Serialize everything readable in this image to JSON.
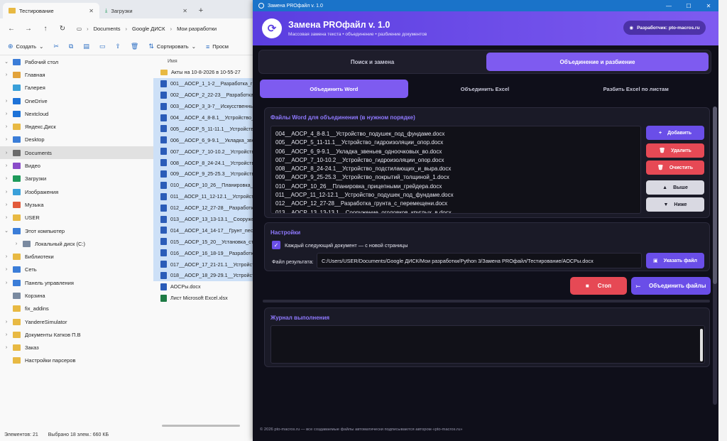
{
  "explorer": {
    "tabs": [
      {
        "label": "Тестирование",
        "active": true
      },
      {
        "label": "Загрузки",
        "active": false
      }
    ],
    "address": [
      "Documents",
      "Google ДИСК",
      "Мои разработки"
    ],
    "commands": {
      "create": "Создать",
      "sort": "Сортировать",
      "view": "Просм"
    },
    "nav_items": [
      {
        "label": "Рабочий стол",
        "expand": "⌄",
        "color": "#3b7dd8",
        "sel": false
      },
      {
        "label": "Главная",
        "expand": "›",
        "color": "#e2a33b",
        "sel": false
      },
      {
        "label": "Галерея",
        "expand": "",
        "color": "#3aa0d9",
        "sel": false
      },
      {
        "label": "OneDrive",
        "expand": "›",
        "color": "#1e73d8",
        "sel": false
      },
      {
        "label": "Nextcloud",
        "expand": "›",
        "color": "#1e73d8",
        "sel": false
      },
      {
        "label": "Яндекс.Диск",
        "expand": "›",
        "color": "#e8b943",
        "sel": false
      },
      {
        "label": "Desktop",
        "expand": "›",
        "color": "#3b7dd8",
        "sel": false
      },
      {
        "label": "Documents",
        "expand": "›",
        "color": "#6b6b6b",
        "sel": true
      },
      {
        "label": "Видео",
        "expand": "›",
        "color": "#8a4cc9",
        "sel": false
      },
      {
        "label": "Загрузки",
        "expand": "›",
        "color": "#1e9a5a",
        "sel": false
      },
      {
        "label": "Изображения",
        "expand": "›",
        "color": "#3aa0d9",
        "sel": false
      },
      {
        "label": "Музыка",
        "expand": "›",
        "color": "#e25b3b",
        "sel": false
      },
      {
        "label": "USER",
        "expand": "›",
        "color": "#e8b943",
        "sel": false
      },
      {
        "label": "Этот компьютер",
        "expand": "⌄",
        "color": "#3b7dd8",
        "sel": false
      },
      {
        "label": "Локальный диск (C:)",
        "expand": "›",
        "color": "#7a8aa0",
        "sel": false
      },
      {
        "label": "Библиотеки",
        "expand": "›",
        "color": "#e8b943",
        "sel": false
      },
      {
        "label": "Сеть",
        "expand": "›",
        "color": "#3b7dd8",
        "sel": false
      },
      {
        "label": "Панель управления",
        "expand": "›",
        "color": "#3b7dd8",
        "sel": false
      },
      {
        "label": "Корзина",
        "expand": "",
        "color": "#7a8aa0",
        "sel": false
      },
      {
        "label": "fix_addins",
        "expand": "",
        "color": "#e8b943",
        "sel": false
      },
      {
        "label": "YandereSimulator",
        "expand": "›",
        "color": "#e8b943",
        "sel": false
      },
      {
        "label": "Документы Катков П.В",
        "expand": "›",
        "color": "#e8b943",
        "sel": false
      },
      {
        "label": "Заказ",
        "expand": "›",
        "color": "#e8b943",
        "sel": false
      },
      {
        "label": "Настройки парсеров",
        "expand": "",
        "color": "#e8b943",
        "sel": false
      }
    ],
    "column_header": "Имя",
    "files": [
      {
        "name": "Акты на 10-8-2026 в 10-55-27",
        "kind": "folder",
        "sel": false
      },
      {
        "name": "001__АОСР_1_1-2__Разработка_грунт",
        "kind": "doc",
        "sel": true
      },
      {
        "name": "002__АОСР_2_22-23__Разработка_грун",
        "kind": "doc",
        "sel": true
      },
      {
        "name": "003__АОСР_3_3-7__Искусственные_с",
        "kind": "doc",
        "sel": true
      },
      {
        "name": "004__АОСР_4_8-8.1__Устройство_под",
        "kind": "doc",
        "sel": true
      },
      {
        "name": "005__АОСР_5_11-11.1__Устройство_г",
        "kind": "doc",
        "sel": true
      },
      {
        "name": "006__АОСР_6_9-9.1__Укладка_звенье",
        "kind": "doc",
        "sel": true
      },
      {
        "name": "007__АОСР_7_10-10.2__Устройство_ги",
        "kind": "doc",
        "sel": true
      },
      {
        "name": "008__АОСР_8_24-24.1__Устройство_по",
        "kind": "doc",
        "sel": true
      },
      {
        "name": "009__АОСР_9_25-25.3__Устройство_п",
        "kind": "doc",
        "sel": true
      },
      {
        "name": "010__АОСР_10_26__Планировка_приц",
        "kind": "doc",
        "sel": true
      },
      {
        "name": "011__АОСР_11_12-12.1__Устройство_",
        "kind": "doc",
        "sel": true
      },
      {
        "name": "012__АОСР_12_27-28__Разработка_гру",
        "kind": "doc",
        "sel": true
      },
      {
        "name": "013__АОСР_13_13-13.1__Сооружение",
        "kind": "doc",
        "sel": true
      },
      {
        "name": "014__АОСР_14_14-17__Грунт_песчан",
        "kind": "doc",
        "sel": true
      },
      {
        "name": "015__АОСР_15_20__Установка_столб",
        "kind": "doc",
        "sel": true
      },
      {
        "name": "016__АОСР_16_18-19__Разработка_гр",
        "kind": "doc",
        "sel": true
      },
      {
        "name": "017__АОСР_17_21-21.1__Устройство_",
        "kind": "doc",
        "sel": true
      },
      {
        "name": "018__АОСР_18_29-29.1__Устройство_",
        "kind": "doc",
        "sel": true
      },
      {
        "name": "АОСРы.docx",
        "kind": "doc",
        "sel": false
      },
      {
        "name": "Лист Microsoft Excel.xlsx",
        "kind": "xls",
        "sel": false
      }
    ],
    "status": {
      "count": "Элементов: 21",
      "selected": "Выбрано 18 элем.: 660 КБ"
    }
  },
  "app": {
    "window_title": "Замена PROфайл v. 1.0",
    "header_title": "Замена PROфайл v. 1.0",
    "header_sub": "Массовая замена текста  •  объединение  •  разбиение документов",
    "dev_label": "Разработчик: pto-macros.ru",
    "main_tabs": [
      {
        "label": "Поиск и замена",
        "active": false
      },
      {
        "label": "Объединение и разбиение",
        "active": true
      }
    ],
    "sub_tabs": [
      {
        "label": "Объединить Word",
        "active": true
      },
      {
        "label": "Объединить Excel",
        "active": false
      },
      {
        "label": "Разбить Excel по листам",
        "active": false
      }
    ],
    "files_panel_title": "Файлы Word для объединения (в нужном порядке)",
    "word_files": [
      "004__АОСР_4_8-8.1__Устройство_подушек_под_фундаме.docx",
      "005__АОСР_5_11-11.1__Устройство_гидроизоляции_опор.docx",
      "006__АОСР_6_9-9.1__Укладка_звеньев_одноочковых_во.docx",
      "007__АОСР_7_10-10.2__Устройство_гидроизоляции_опор.docx",
      "008__АОСР_8_24-24.1__Устройство_подстилающих_и_выра.docx",
      "009__АОСР_9_25-25.3__Устройство_покрытий_толщиной_1.docx",
      "010__АОСР_10_26__Планировка_прицепными_грейдера.docx",
      "011__АОСР_11_12-12.1__Устройство_подушек_под_фундаме.docx",
      "012__АОСР_12_27-28__Разработка_грунта_с_перемещени.docx",
      "013__АОСР_13_13-13.1__Сооружение_оголовков_круглых_в.docx"
    ],
    "side_buttons": {
      "add": "Добавить",
      "remove": "Удалить",
      "clear": "Очистить",
      "up": "Выше",
      "down": "Ниже"
    },
    "settings_title": "Настройки",
    "new_page_label": "Каждый следующий документ — с новой страницы",
    "output_label": "Файл результата:",
    "output_path": "C:/Users/USER/Documents/Google ДИСК/Мои разработки/Python 3/Замена PROфайл/Тестирование/АОСРы.docx",
    "browse_label": "Указать файл",
    "stop_label": "Стоп",
    "merge_label": "Объединить файлы",
    "log_title": "Журнал выполнения",
    "footer": "© 2026 pto-macros.ru — все создаваемые файлы автоматически подписываются автором «pto-macros.ru»",
    "progress": 0
  }
}
